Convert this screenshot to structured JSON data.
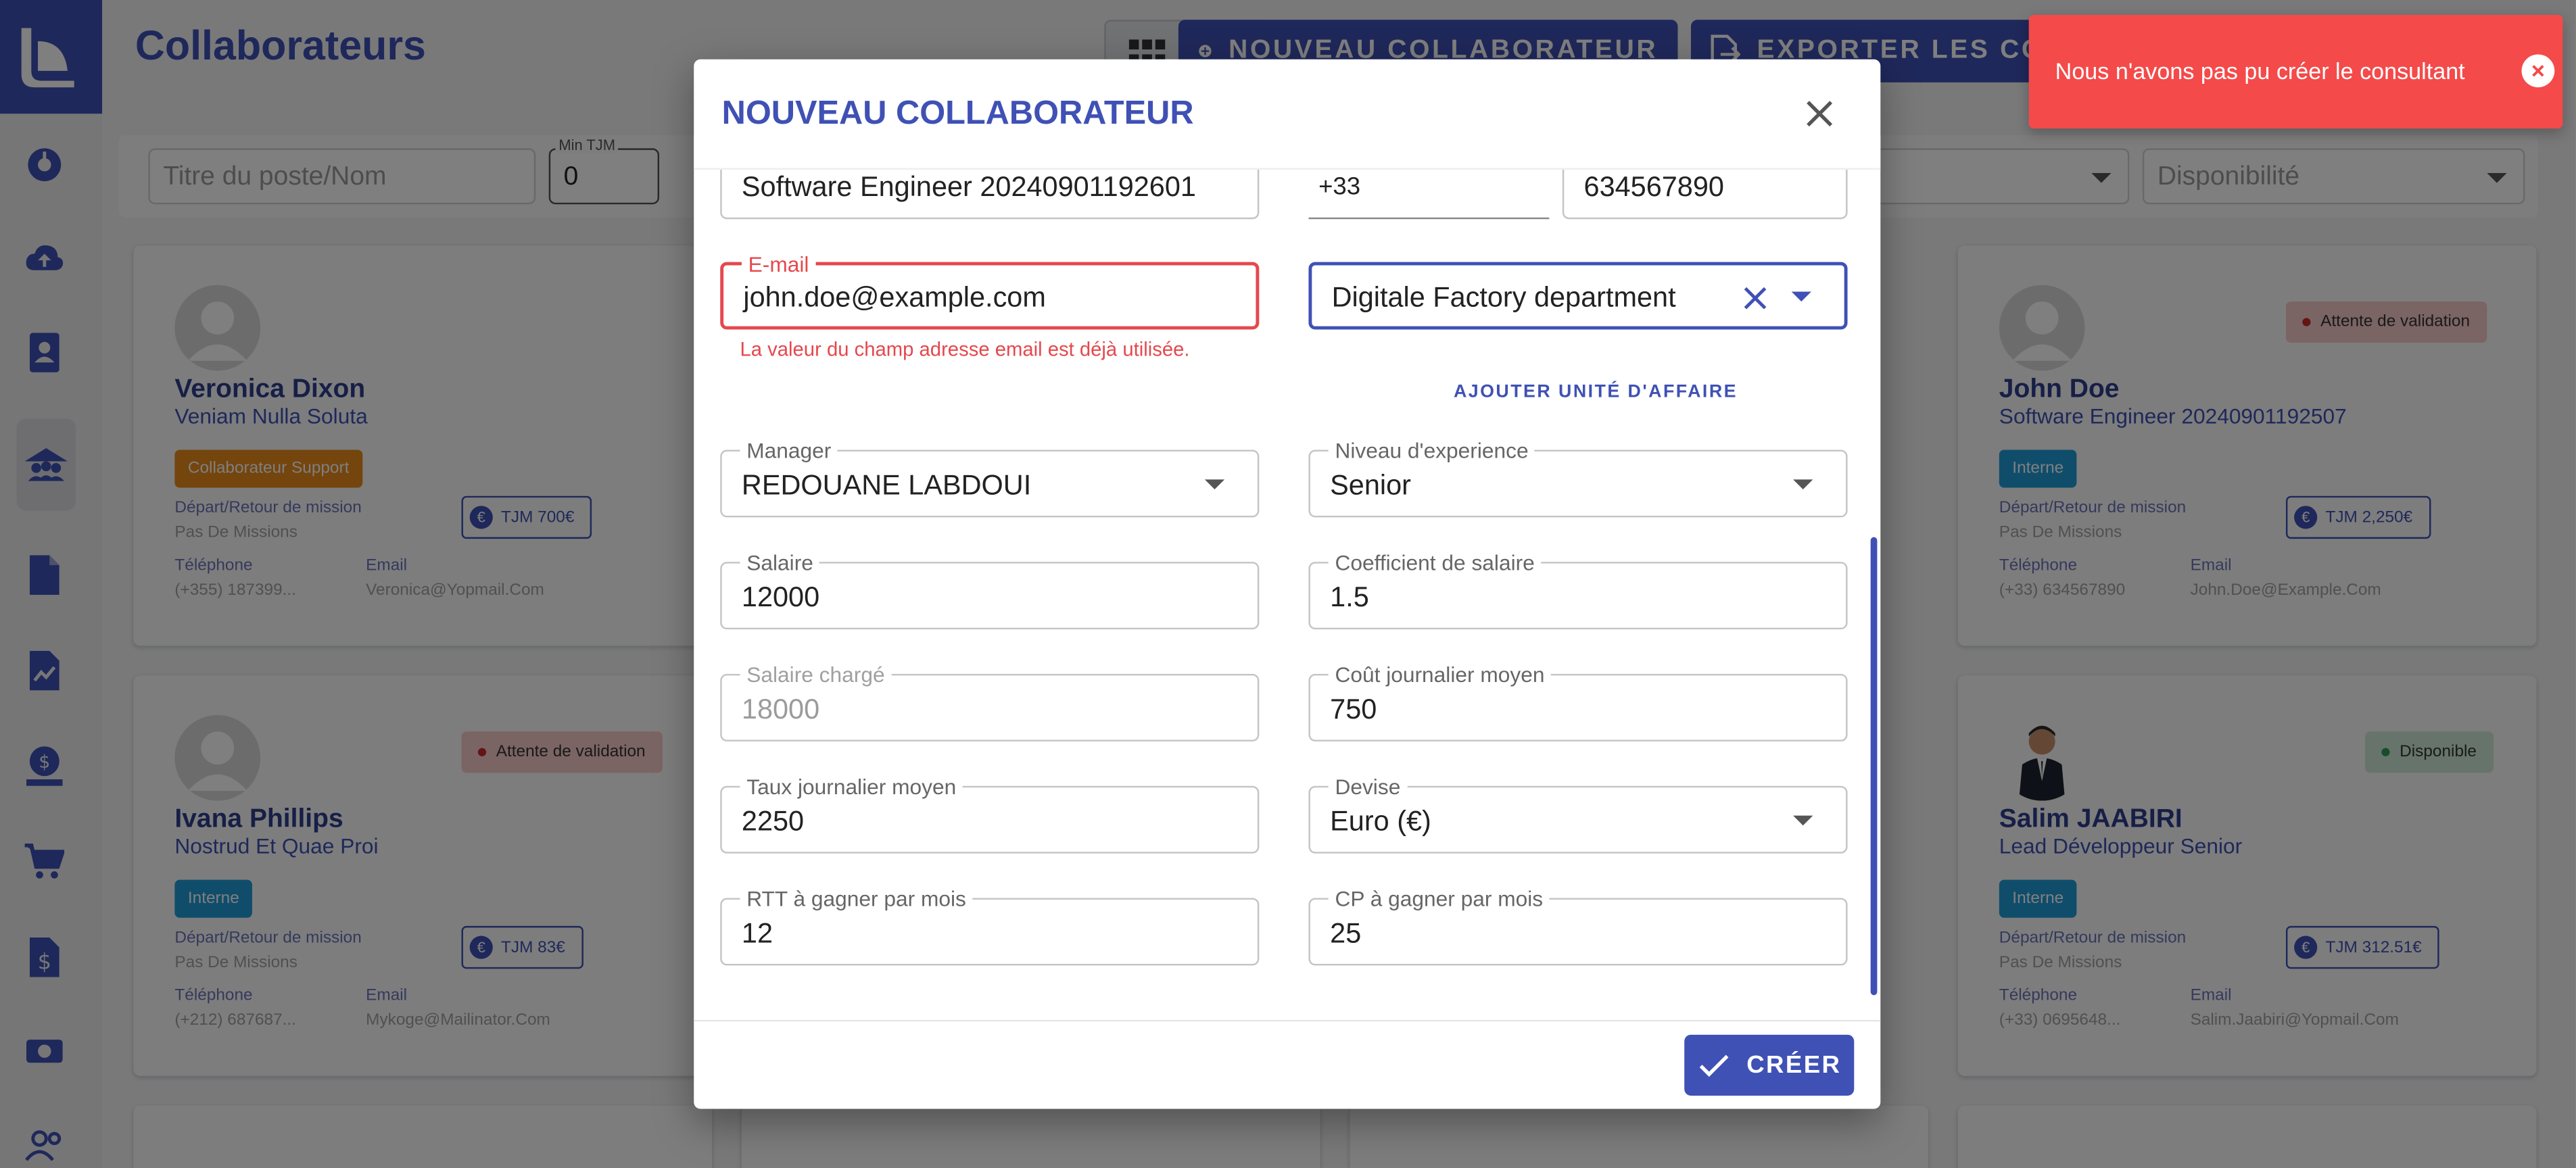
{
  "header": {
    "title": "Collaborateurs",
    "new_button": "NOUVEAU COLLABORATEUR",
    "export_button": "EXPORTER LES COL"
  },
  "filters": {
    "search_placeholder": "Titre du poste/Nom",
    "min_tjm_label": "Min TJM",
    "min_tjm_value": "0",
    "availability_placeholder": "Disponibilité"
  },
  "cards": [
    {
      "name": "Veronica Dixon",
      "subtitle": "Veniam Nulla Soluta",
      "chip": "Collaborateur Support",
      "chip_color": "#e88a1a",
      "mission_label": "Départ/Retour de mission",
      "mission_value": "Pas De Missions",
      "tjm": "TJM 700€",
      "phone_label": "Téléphone",
      "phone": "(+355) 187399...",
      "email_label": "Email",
      "email": "Veronica@Yopmail.Com"
    },
    {
      "name": "John Doe",
      "subtitle": "Software Engineer 20240901192507",
      "chip": "Interne",
      "chip_color": "#1e9bd7",
      "status": "Attente de validation",
      "mission_label": "Départ/Retour de mission",
      "mission_value": "Pas De Missions",
      "tjm": "TJM 2,250€",
      "phone_label": "Téléphone",
      "phone": "(+33) 634567890",
      "email_label": "Email",
      "email": "John.Doe@Example.Com"
    },
    {
      "name": "Ivana Phillips",
      "subtitle": "Nostrud Et Quae Proi",
      "chip": "Interne",
      "chip_color": "#1e9bd7",
      "status": "Attente de validation",
      "mission_label": "Départ/Retour de mission",
      "mission_value": "Pas De Missions",
      "tjm": "TJM 83€",
      "phone_label": "Téléphone",
      "phone": "(+212) 687687...",
      "email_label": "Email",
      "email": "Mykoge@Mailinator.Com"
    },
    {
      "name": "Salim JAABIRI",
      "subtitle": "Lead Développeur Senior",
      "chip": "Interne",
      "chip_color": "#1e9bd7",
      "status": "Disponible",
      "mission_label": "Départ/Retour de mission",
      "mission_value": "Pas De Missions",
      "tjm": "TJM 312.51€",
      "phone_label": "Téléphone",
      "phone": "(+33) 0695648...",
      "email_label": "Email",
      "email": "Salim.Jaabiri@Yopmail.Com"
    }
  ],
  "modal": {
    "title": "NOUVEAU COLLABORATEUR",
    "job_title_value": "Software Engineer 20240901192601",
    "phone_code": "+33",
    "phone_number": "634567890",
    "email_label": "E-mail",
    "email_value": "john.doe@example.com",
    "email_error": "La valeur du champ adresse email est déjà utilisée.",
    "business_unit_value": "Digitale Factory department",
    "add_business_unit": "AJOUTER UNITÉ D'AFFAIRE",
    "manager_label": "Manager",
    "manager_value": "REDOUANE LABDOUI",
    "experience_label": "Niveau d'experience",
    "experience_value": "Senior",
    "salary_label": "Salaire",
    "salary_value": "12000",
    "salary_coef_label": "Coefficient de salaire",
    "salary_coef_value": "1.5",
    "loaded_salary_label": "Salaire chargé",
    "loaded_salary_value": "18000",
    "avg_daily_cost_label": "Coût journalier moyen",
    "avg_daily_cost_value": "750",
    "avg_daily_rate_label": "Taux journalier moyen",
    "avg_daily_rate_value": "2250",
    "currency_label": "Devise",
    "currency_value": "Euro (€)",
    "rtt_label": "RTT à gagner par mois",
    "rtt_value": "12",
    "cp_label": "CP à gagner par mois",
    "cp_value": "25",
    "create_button": "CRÉER"
  },
  "toast": {
    "message": "Nous n'avons pas pu créer le consultant",
    "color": "#f44a4a"
  },
  "colors": {
    "primary": "#3f51b5",
    "error": "#e5484d"
  }
}
